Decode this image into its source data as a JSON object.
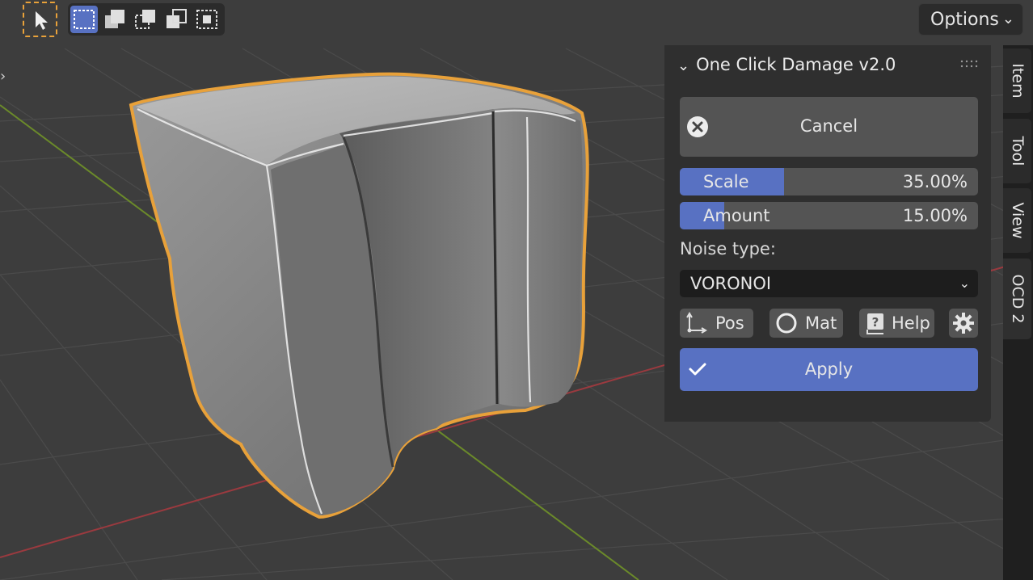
{
  "toolbar": {
    "tools": [
      "select-tool",
      "mode-new",
      "mode-extend",
      "mode-subtract",
      "mode-invert",
      "mode-intersect"
    ],
    "options_label": "Options"
  },
  "panel": {
    "title": "One Click Damage v2.0",
    "cancel_label": "Cancel",
    "scale": {
      "name": "Scale",
      "value": "35.00%",
      "fraction": 0.35
    },
    "amount": {
      "name": "Amount",
      "value": "15.00%",
      "fraction": 0.15
    },
    "noise_label": "Noise type:",
    "noise_value": "VORONOI",
    "buttons": {
      "pos": "Pos",
      "mat": "Mat",
      "help": "Help"
    },
    "apply_label": "Apply"
  },
  "side_tabs": [
    "Item",
    "Tool",
    "View",
    "OCD 2"
  ],
  "colors": {
    "accent": "#5871c2",
    "selection_outline": "#e8a13a",
    "panel_bg": "#2f2f2f",
    "button_bg": "#545454",
    "viewport_bg": "#3d3d3d",
    "x_axis": "#9a3a3f",
    "y_axis": "#6b8a2a"
  },
  "icons": [
    "cursor-arrow-icon",
    "cancel-x-icon",
    "axes-icon",
    "circle-icon",
    "help-book-icon",
    "gear-icon",
    "checkmark-icon",
    "chevron-down-icon",
    "grip-dots-icon"
  ]
}
